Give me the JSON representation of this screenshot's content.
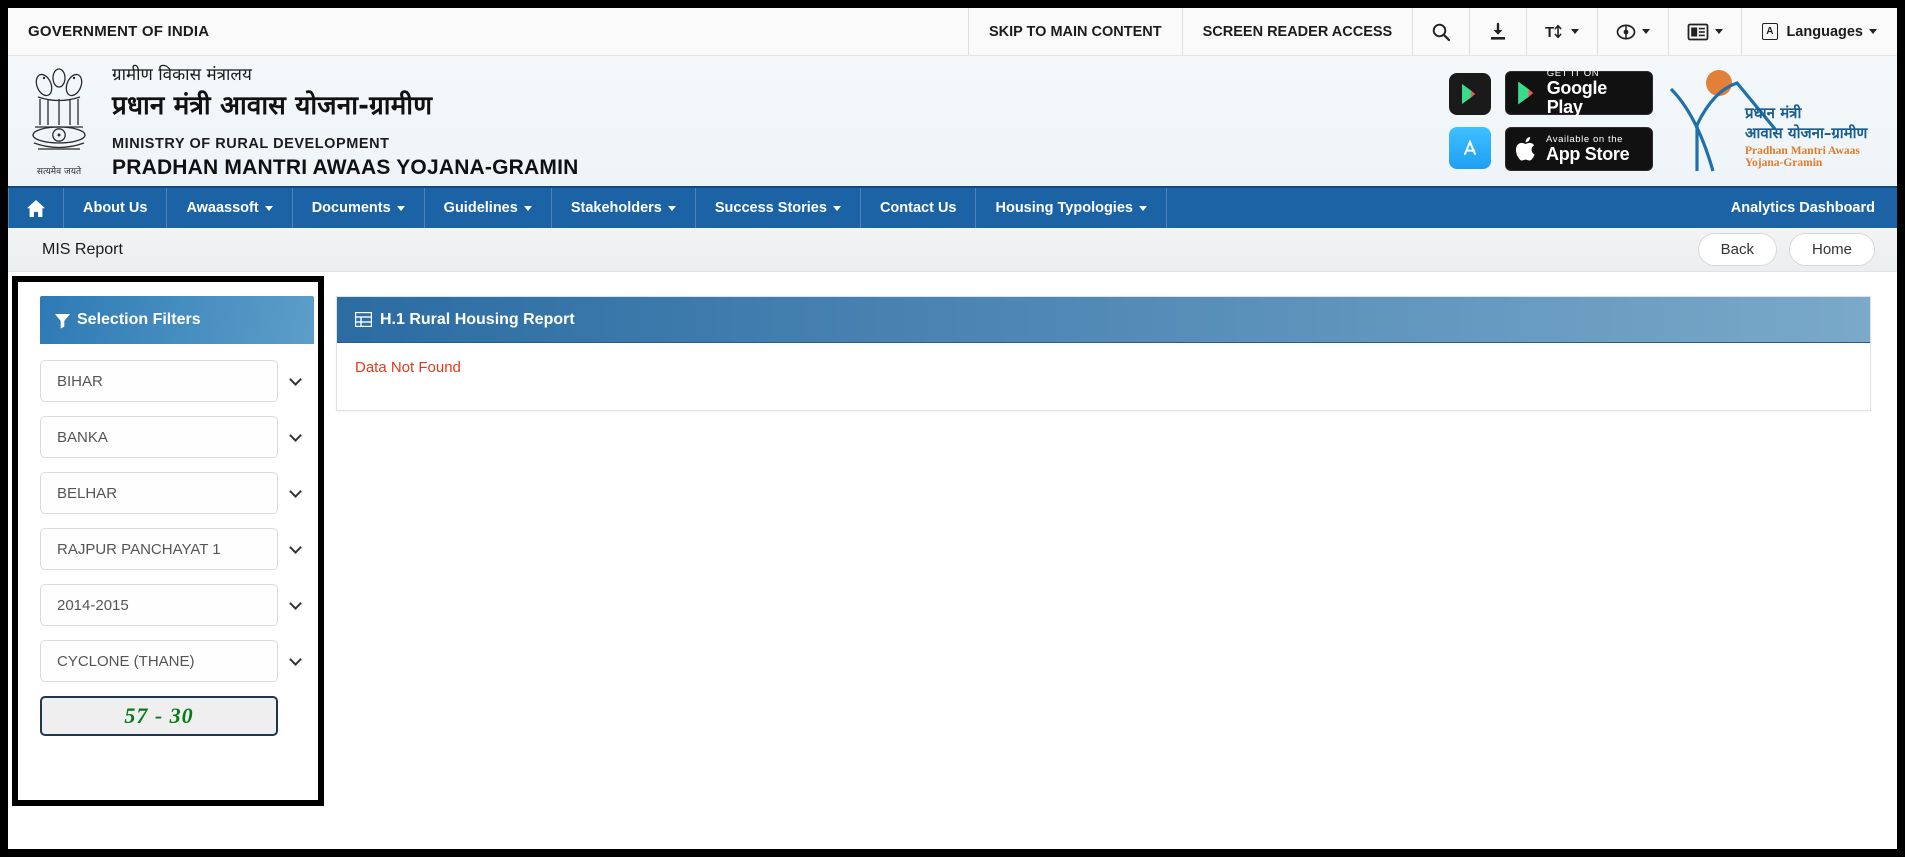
{
  "topbar": {
    "gov_label": "GOVERNMENT OF INDIA",
    "skip": "SKIP TO MAIN CONTENT",
    "screen_reader": "SCREEN READER ACCESS",
    "languages": "Languages",
    "lang_badge": "A",
    "icons": [
      "search-icon",
      "download-icon",
      "text-size-icon",
      "accessibility-icon",
      "contrast-icon"
    ]
  },
  "header": {
    "hindi_ministry": "ग्रामीण विकास मंत्रालय",
    "hindi_scheme": "प्रधान मंत्री आवास योजना-ग्रामीण",
    "english_ministry": "MINISTRY OF RURAL DEVELOPMENT",
    "english_scheme": "PRADHAN MANTRI AWAAS YOJANA-GRAMIN",
    "emblem_motto": "सत्यमेव जयते",
    "google_play_small": "GET IT ON",
    "google_play_big": "Google Play",
    "app_store_small": "Available on the",
    "app_store_big": "App Store",
    "pmay_logo_hi1": "प्रधान मंत्री",
    "pmay_logo_hi2": "आवास योजना–ग्रामीण",
    "pmay_logo_en": "Pradhan Mantri Awaas Yojana-Gramin"
  },
  "nav": {
    "items": [
      {
        "label": "",
        "icon": "home-icon",
        "has_caret": false
      },
      {
        "label": "About Us",
        "has_caret": false
      },
      {
        "label": "Awaassoft",
        "has_caret": true
      },
      {
        "label": "Documents",
        "has_caret": true
      },
      {
        "label": "Guidelines",
        "has_caret": true
      },
      {
        "label": "Stakeholders",
        "has_caret": true
      },
      {
        "label": "Success Stories",
        "has_caret": true
      },
      {
        "label": "Contact Us",
        "has_caret": false
      },
      {
        "label": "Housing Typologies",
        "has_caret": true
      }
    ],
    "analytics": "Analytics Dashboard",
    "bg_color": "#1b63a5"
  },
  "misbar": {
    "title": "MIS Report",
    "back": "Back",
    "home": "Home"
  },
  "sidebar": {
    "panel_title": "Selection Filters",
    "filters": [
      {
        "name": "state-select",
        "value": "BIHAR"
      },
      {
        "name": "district-select",
        "value": "BANKA"
      },
      {
        "name": "block-select",
        "value": "BELHAR"
      },
      {
        "name": "panchayat-select",
        "value": "RAJPUR PANCHAYAT 1"
      },
      {
        "name": "year-select",
        "value": "2014-2015"
      },
      {
        "name": "scheme-select",
        "value": "CYCLONE (THANE)"
      }
    ],
    "captcha": "57 - 30"
  },
  "report": {
    "title": "H.1 Rural Housing Report",
    "message": "Data Not Found",
    "message_color": "#e03b1c"
  }
}
